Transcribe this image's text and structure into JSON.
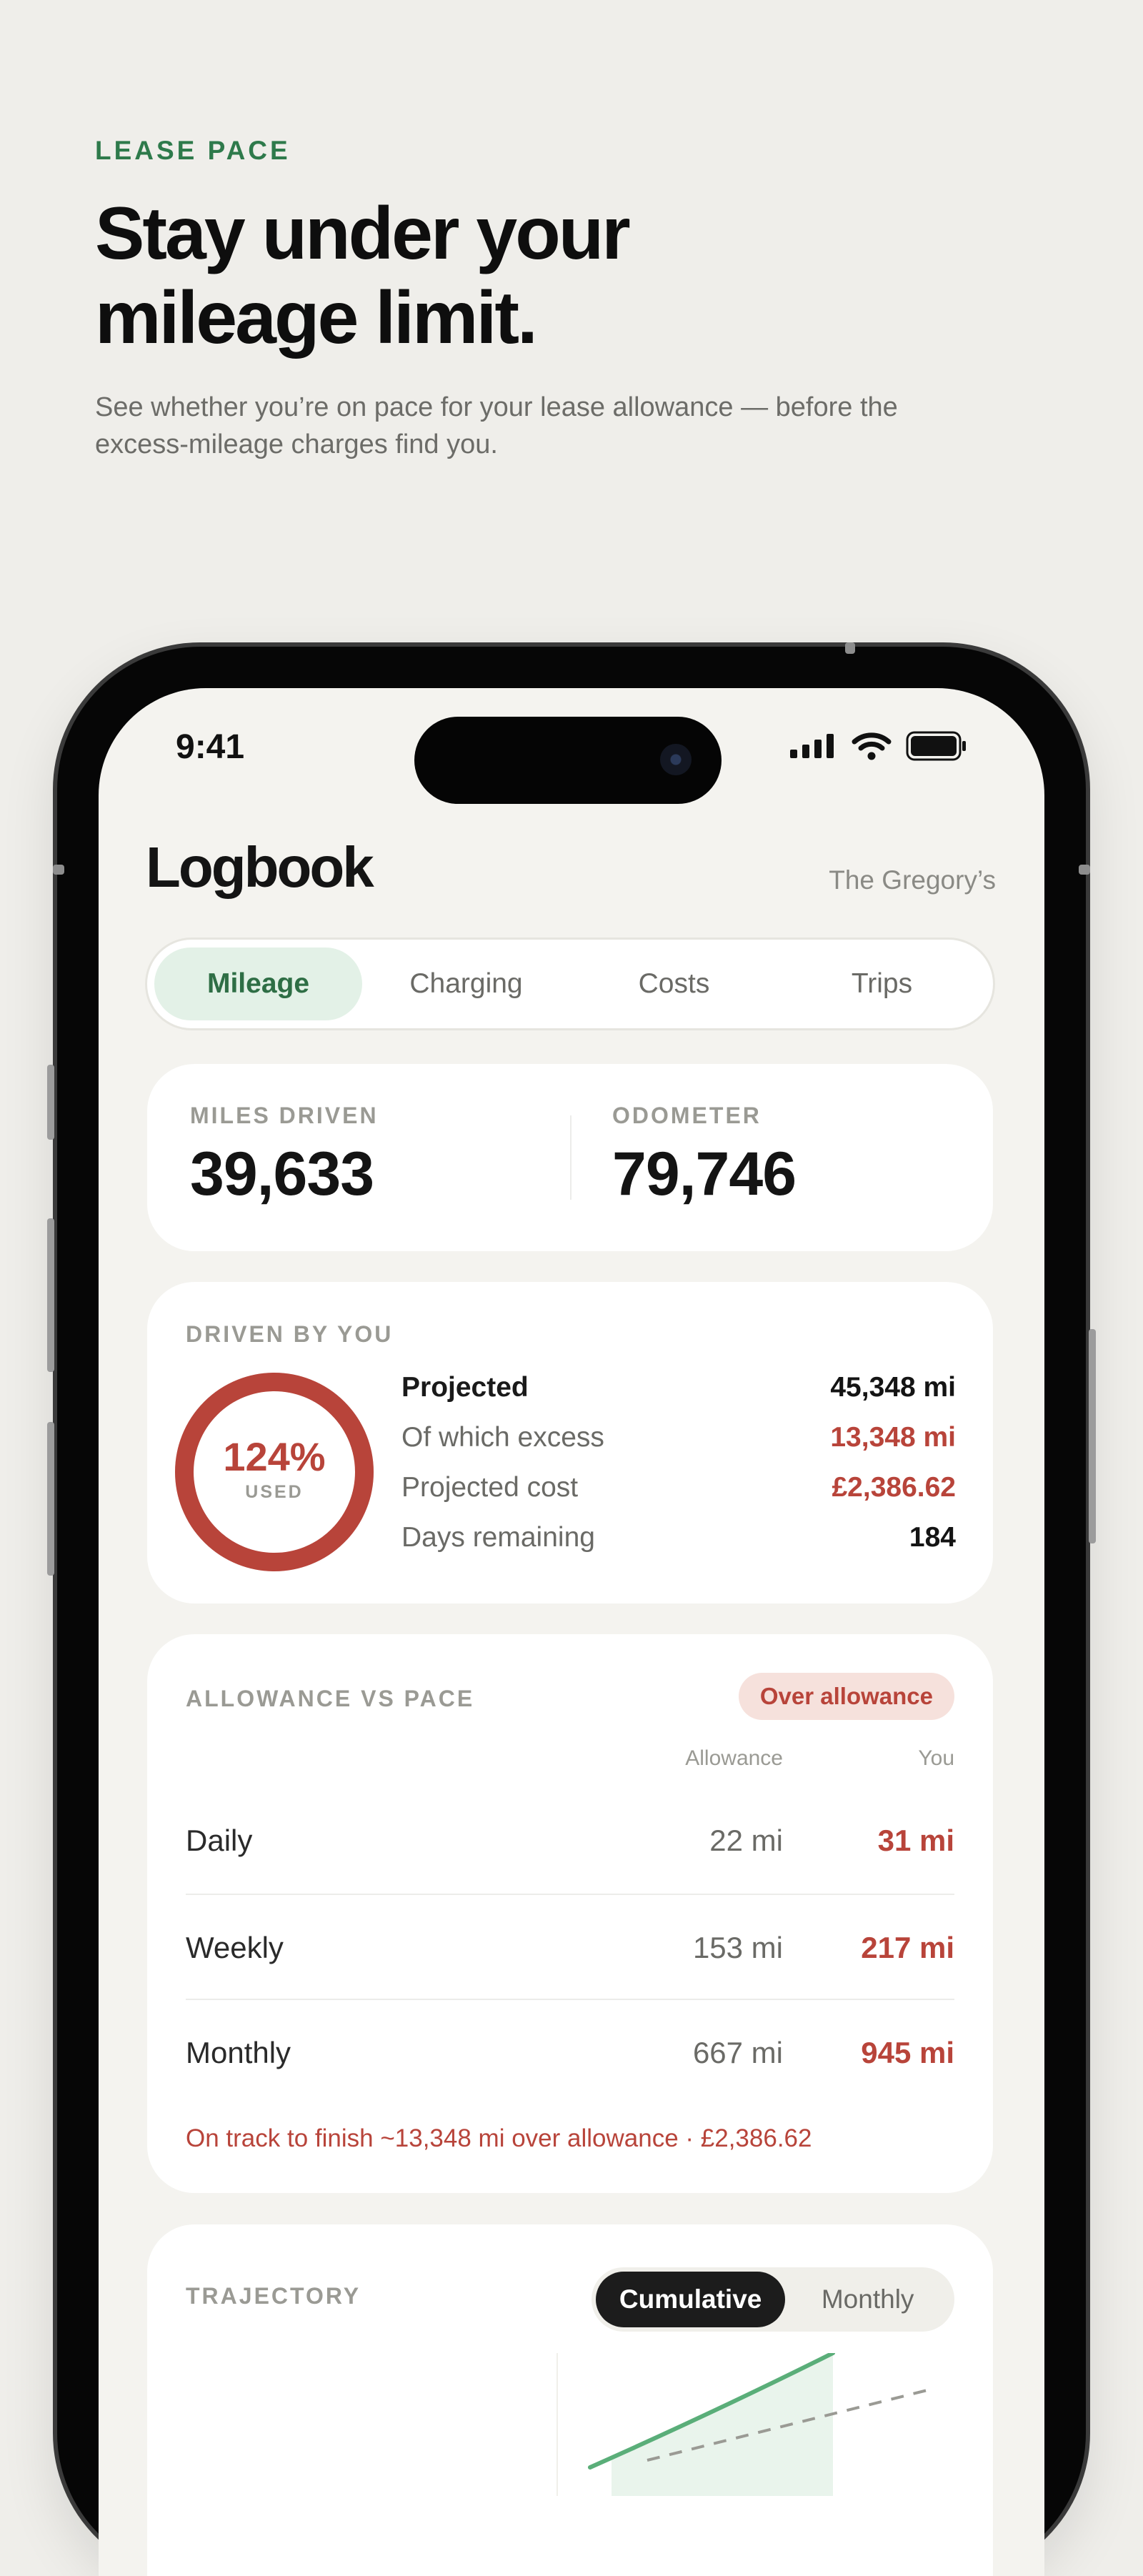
{
  "hero": {
    "eyebrow": "LEASE PACE",
    "headline_line1": "Stay under your",
    "headline_line2": "mileage limit.",
    "subline": "See whether you’re on pace for your lease allowance — before the excess-mileage charges find you."
  },
  "status_bar": {
    "time": "9:41"
  },
  "app": {
    "title": "Logbook",
    "owner": "The Gregory’s",
    "tabs": [
      {
        "label": "Mileage",
        "active": true
      },
      {
        "label": "Charging",
        "active": false
      },
      {
        "label": "Costs",
        "active": false
      },
      {
        "label": "Trips",
        "active": false
      }
    ]
  },
  "kpis": {
    "miles_driven_label": "MILES DRIVEN",
    "miles_driven_value": "39,633",
    "odometer_label": "ODOMETER",
    "odometer_value": "79,746"
  },
  "driven": {
    "label": "DRIVEN BY YOU",
    "ring_percent_text": "124%",
    "ring_percent_value": 124,
    "ring_sublabel": "USED",
    "rows": [
      {
        "key": "Projected",
        "value": "45,348 mi"
      },
      {
        "key": "Of which excess",
        "value": "13,348 mi"
      },
      {
        "key": "Projected cost",
        "value": "£2,386.62"
      },
      {
        "key": "Days remaining",
        "value": "184"
      }
    ]
  },
  "allowance": {
    "label": "ALLOWANCE VS PACE",
    "badge": "Over allowance",
    "col_allowance": "Allowance",
    "col_you": "You",
    "rows": [
      {
        "period": "Daily",
        "allowance": "22 mi",
        "you": "31 mi"
      },
      {
        "period": "Weekly",
        "allowance": "153 mi",
        "you": "217 mi"
      },
      {
        "period": "Monthly",
        "allowance": "667 mi",
        "you": "945 mi"
      }
    ],
    "note": "On track to finish ~13,348 mi over allowance · £2,386.62"
  },
  "trajectory": {
    "label": "TRAJECTORY",
    "options": [
      {
        "label": "Cumulative",
        "selected": true
      },
      {
        "label": "Monthly",
        "selected": false
      }
    ]
  },
  "colors": {
    "accent_green": "#2e7a4b",
    "alert_red": "#b8443a",
    "background": "#efeeea"
  }
}
